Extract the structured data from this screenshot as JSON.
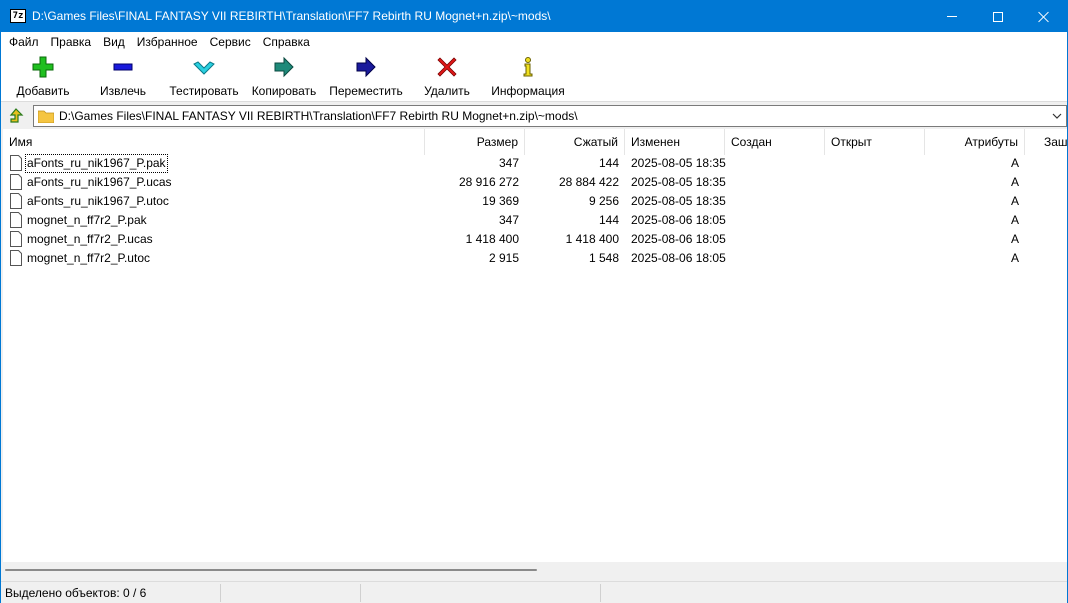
{
  "window": {
    "title": "D:\\Games Files\\FINAL FANTASY VII REBIRTH\\Translation\\FF7 Rebirth RU Mognet+n.zip\\~mods\\",
    "app_icon_text": "7z"
  },
  "menu": [
    "Файл",
    "Правка",
    "Вид",
    "Избранное",
    "Сервис",
    "Справка"
  ],
  "toolbar": [
    {
      "label": "Добавить",
      "icon": "add-plus-icon"
    },
    {
      "label": "Извлечь",
      "icon": "extract-minus-icon"
    },
    {
      "label": "Тестировать",
      "icon": "test-check-icon"
    },
    {
      "label": "Копировать",
      "icon": "copy-arrow-icon"
    },
    {
      "label": "Переместить",
      "icon": "move-arrow-icon"
    },
    {
      "label": "Удалить",
      "icon": "delete-x-icon"
    },
    {
      "label": "Информация",
      "icon": "info-icon"
    }
  ],
  "address": {
    "path": "D:\\Games Files\\FINAL FANTASY VII REBIRTH\\Translation\\FF7 Rebirth RU Mognet+n.zip\\~mods\\"
  },
  "columns": [
    "Имя",
    "Размер",
    "Сжатый",
    "Изменен",
    "Создан",
    "Открыт",
    "Атрибуты",
    "Зашифрован"
  ],
  "files": [
    {
      "name": "aFonts_ru_nik1967_P.pak",
      "size": "347",
      "packed": "144",
      "modified": "2025-08-05 18:35",
      "created": "",
      "accessed": "",
      "attributes": "A"
    },
    {
      "name": "aFonts_ru_nik1967_P.ucas",
      "size": "28 916 272",
      "packed": "28 884 422",
      "modified": "2025-08-05 18:35",
      "created": "",
      "accessed": "",
      "attributes": "A"
    },
    {
      "name": "aFonts_ru_nik1967_P.utoc",
      "size": "19 369",
      "packed": "9 256",
      "modified": "2025-08-05 18:35",
      "created": "",
      "accessed": "",
      "attributes": "A"
    },
    {
      "name": "mognet_n_ff7r2_P.pak",
      "size": "347",
      "packed": "144",
      "modified": "2025-08-06 18:05",
      "created": "",
      "accessed": "",
      "attributes": "A"
    },
    {
      "name": "mognet_n_ff7r2_P.ucas",
      "size": "1 418 400",
      "packed": "1 418 400",
      "modified": "2025-08-06 18:05",
      "created": "",
      "accessed": "",
      "attributes": "A"
    },
    {
      "name": "mognet_n_ff7r2_P.utoc",
      "size": "2 915",
      "packed": "1 548",
      "modified": "2025-08-06 18:05",
      "created": "",
      "accessed": "",
      "attributes": "A"
    }
  ],
  "status": {
    "selected": "Выделено объектов: 0 / 6",
    "pane2": "",
    "pane3": ""
  },
  "colors": {
    "titlebar": "#0078d4",
    "window_bg": "#f0f0f0"
  }
}
